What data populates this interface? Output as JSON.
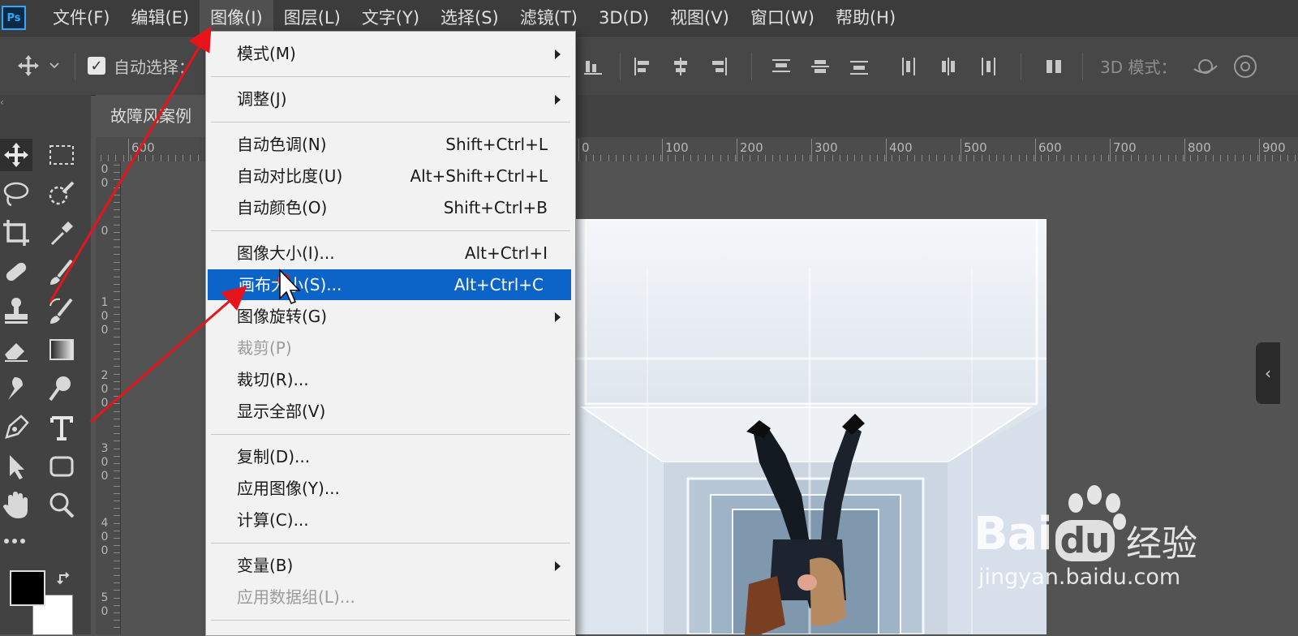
{
  "app": {
    "logo": "Ps"
  },
  "menubar": {
    "items": [
      "文件(F)",
      "编辑(E)",
      "图像(I)",
      "图层(L)",
      "文字(Y)",
      "选择(S)",
      "滤镜(T)",
      "3D(D)",
      "视图(V)",
      "窗口(W)",
      "帮助(H)"
    ],
    "active_index": 2
  },
  "options_bar": {
    "auto_select_label": "自动选择：",
    "auto_select_checked": true,
    "mode_3d_label": "3D 模式："
  },
  "document": {
    "tab_title": "故障风案例"
  },
  "rulers": {
    "top_labels": [
      "600",
      "0",
      "100",
      "200",
      "300",
      "400",
      "500",
      "600",
      "700",
      "800",
      "900"
    ],
    "left_labels": [
      "0 0",
      "0",
      "1 0 0",
      "2 0 0",
      "3 0 0",
      "4 0 0",
      "5 0"
    ]
  },
  "image_menu": {
    "items": [
      {
        "type": "item",
        "label": "模式(M)",
        "submenu": true
      },
      {
        "type": "sep"
      },
      {
        "type": "item",
        "label": "调整(J)",
        "submenu": true
      },
      {
        "type": "sep"
      },
      {
        "type": "item",
        "label": "自动色调(N)",
        "shortcut": "Shift+Ctrl+L"
      },
      {
        "type": "item",
        "label": "自动对比度(U)",
        "shortcut": "Alt+Shift+Ctrl+L"
      },
      {
        "type": "item",
        "label": "自动颜色(O)",
        "shortcut": "Shift+Ctrl+B"
      },
      {
        "type": "sep"
      },
      {
        "type": "item",
        "label": "图像大小(I)...",
        "shortcut": "Alt+Ctrl+I"
      },
      {
        "type": "item",
        "label": "画布大小(S)...",
        "shortcut": "Alt+Ctrl+C",
        "highlighted": true
      },
      {
        "type": "item",
        "label": "图像旋转(G)",
        "submenu": true
      },
      {
        "type": "item",
        "label": "裁剪(P)",
        "disabled": true
      },
      {
        "type": "item",
        "label": "裁切(R)..."
      },
      {
        "type": "item",
        "label": "显示全部(V)"
      },
      {
        "type": "sep"
      },
      {
        "type": "item",
        "label": "复制(D)..."
      },
      {
        "type": "item",
        "label": "应用图像(Y)..."
      },
      {
        "type": "item",
        "label": "计算(C)..."
      },
      {
        "type": "sep"
      },
      {
        "type": "item",
        "label": "变量(B)",
        "submenu": true
      },
      {
        "type": "item",
        "label": "应用数据组(L)...",
        "disabled": true
      },
      {
        "type": "sep"
      }
    ]
  },
  "tools": [
    "move-icon",
    "marquee-icon",
    "lasso-icon",
    "quick-select-icon",
    "crop-icon",
    "eyedropper-icon",
    "healing-icon",
    "brush-icon",
    "stamp-icon",
    "history-brush-icon",
    "eraser-icon",
    "gradient-icon",
    "smudge-icon",
    "dodge-icon",
    "pen-icon",
    "type-icon",
    "path-select-icon",
    "shape-icon",
    "hand-icon",
    "zoom-icon",
    "more-icon"
  ],
  "colors": {
    "foreground": "#000000",
    "background": "#ffffff",
    "menu_highlight": "#0c64c8",
    "annotation": "#e8141c"
  },
  "watermark": {
    "brand": "Bai",
    "brand2": "du",
    "cn": "经验",
    "url": "jingyan.baidu.com"
  }
}
